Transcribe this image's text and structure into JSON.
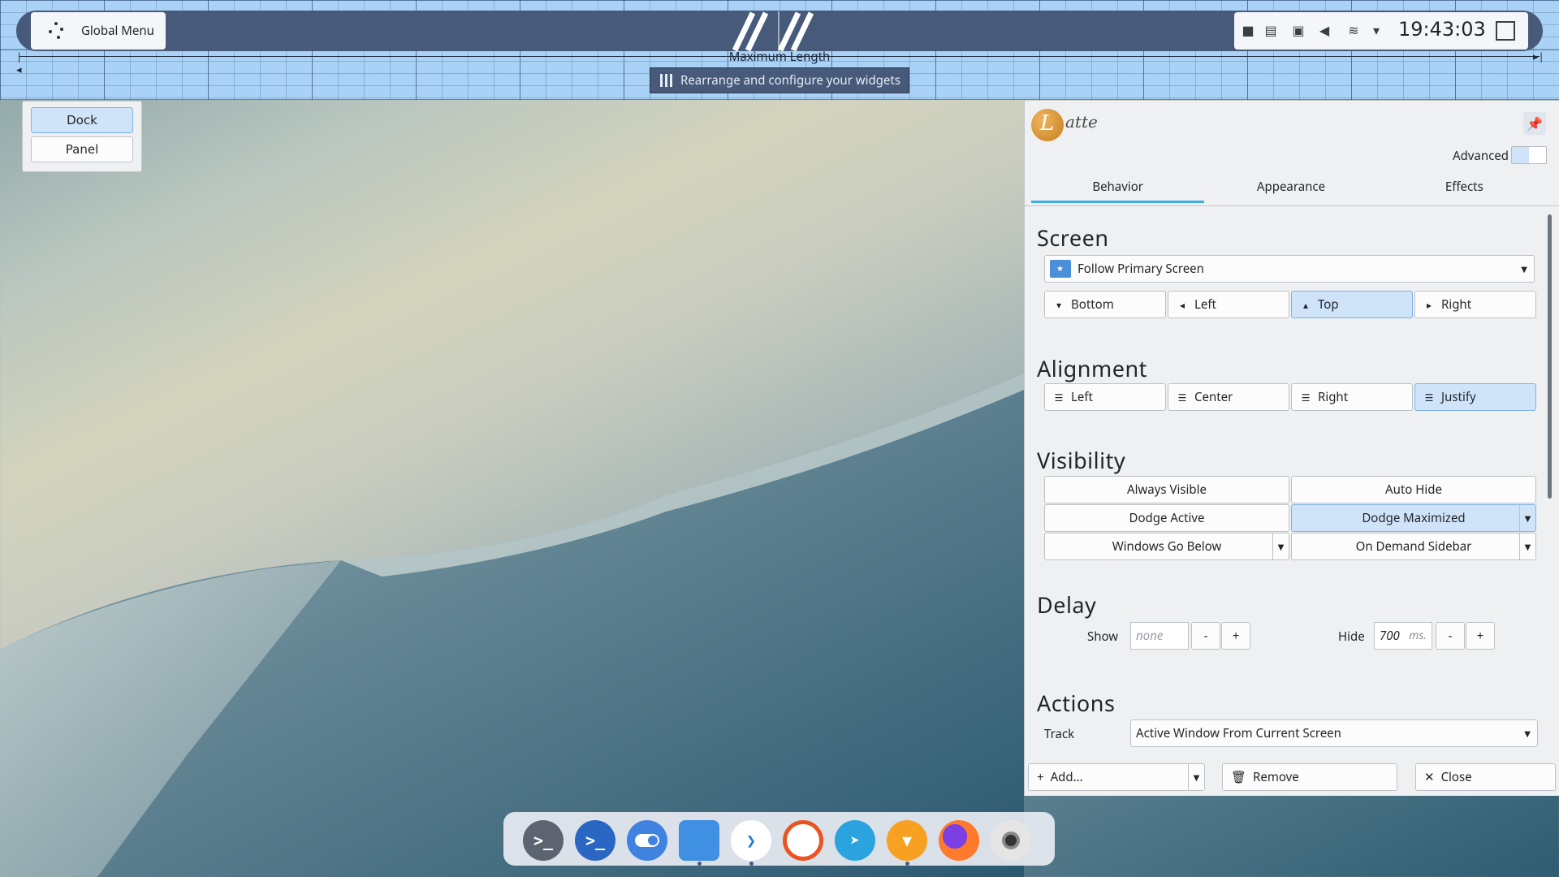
{
  "top_panel": {
    "global_menu_label": "Global Menu",
    "clock": "19:43:03",
    "ruler_label": "Maximum Length",
    "ruler_hint": "Rearrange and configure your widgets"
  },
  "chooser": {
    "items": [
      "Dock",
      "Panel"
    ],
    "selected": "Dock"
  },
  "settings": {
    "app_name": "atte",
    "advanced_label": "Advanced",
    "tabs": [
      "Behavior",
      "Appearance",
      "Effects"
    ],
    "active_tab": "Behavior",
    "screen": {
      "heading": "Screen",
      "selected_screen": "Follow Primary Screen",
      "positions": [
        "Bottom",
        "Left",
        "Top",
        "Right"
      ],
      "selected_position": "Top"
    },
    "alignment": {
      "heading": "Alignment",
      "options": [
        "Left",
        "Center",
        "Right",
        "Justify"
      ],
      "selected": "Justify"
    },
    "visibility": {
      "heading": "Visibility",
      "options": [
        "Always Visible",
        "Auto Hide",
        "Dodge Active",
        "Dodge Maximized",
        "Windows Go Below",
        "On Demand Sidebar"
      ],
      "selected": "Dodge Maximized"
    },
    "delay": {
      "heading": "Delay",
      "show_label": "Show",
      "show_placeholder": "none",
      "hide_label": "Hide",
      "hide_value": "700",
      "hide_unit": "ms.",
      "minus": "-",
      "plus": "+"
    },
    "actions": {
      "heading": "Actions",
      "track_label": "Track",
      "track_value": "Active Window From Current Screen"
    },
    "footer": {
      "add_label": "Add...",
      "remove_label": "Remove",
      "close_label": "Close"
    }
  },
  "dock": {
    "apps": [
      "terminal-icon",
      "konsole-icon",
      "toggle-app-icon",
      "files-icon",
      "vscode-icon",
      "ubuntu-icon",
      "telegram-icon",
      "brave-icon",
      "firefox-icon",
      "camera-icon"
    ],
    "colors": {
      "terminal": "#5b6470",
      "konsole": "#2a67c4",
      "toggle": "#3f82e0",
      "files": "#3f8fe3",
      "vscode": "#ffffff",
      "ubuntu": "#ffffff",
      "telegram": "#2aa3df",
      "brave": "#f7a021",
      "firefox": "#ff7a2a",
      "camera": "#e5e5e5"
    }
  },
  "colors": {
    "panel": "#475a7a",
    "accent": "#3daee9",
    "selection": "#cfe3f9"
  }
}
